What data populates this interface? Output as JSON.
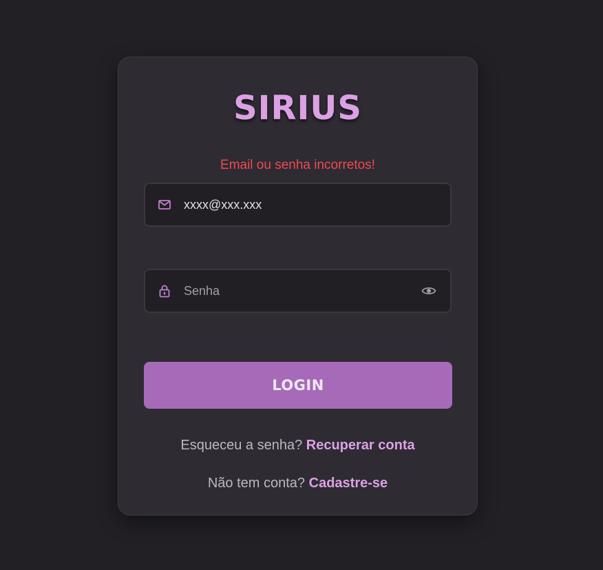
{
  "app": {
    "brand": "SIRIUS"
  },
  "login": {
    "error_message": "Email ou senha incorretos!",
    "email": {
      "value": "xxxx@xxx.xxx",
      "icon": "mail-icon"
    },
    "password": {
      "value": "",
      "placeholder": "Senha",
      "icon": "lock-icon",
      "toggle_icon": "eye-icon"
    },
    "submit_label": "LOGIN",
    "forgot": {
      "text": "Esqueceu a senha?",
      "link": "Recuperar conta"
    },
    "signup": {
      "text": "Não tem conta?",
      "link": "Cadastre-se"
    }
  },
  "colors": {
    "background": "#222025",
    "card": "#2e2b33",
    "accent": "#dda0e4",
    "button": "#a76ab9",
    "error": "#ef4a4f"
  }
}
